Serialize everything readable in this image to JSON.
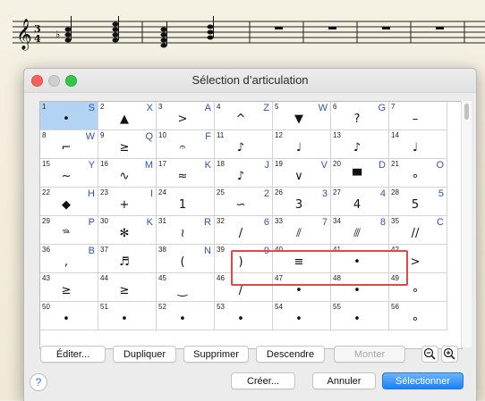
{
  "dialog": {
    "title": "Sélection d’articulation",
    "buttons": {
      "edit": "Éditer...",
      "duplicate": "Dupliquer",
      "delete": "Supprimer",
      "move_down": "Descendre",
      "move_up": "Monter",
      "create": "Créer...",
      "cancel": "Annuler",
      "select": "Sélectionner",
      "help": "?"
    }
  },
  "articulations": [
    {
      "num": "1",
      "key": "S",
      "sym": "•"
    },
    {
      "num": "2",
      "key": "X",
      "sym": "▲"
    },
    {
      "num": "3",
      "key": "A",
      "sym": ">"
    },
    {
      "num": "4",
      "key": "Z",
      "sym": "^"
    },
    {
      "num": "5",
      "key": "W",
      "sym": "▼"
    },
    {
      "num": "6",
      "key": "G",
      "sym": "?"
    },
    {
      "num": "7",
      "key": "",
      "sym": "–"
    },
    {
      "num": "8",
      "key": "W",
      "sym": "⌐"
    },
    {
      "num": "9",
      "key": "Q",
      "sym": "≥"
    },
    {
      "num": "10",
      "key": "F",
      "sym": "𝄐"
    },
    {
      "num": "11",
      "key": "",
      "sym": "♪"
    },
    {
      "num": "12",
      "key": "",
      "sym": "♩"
    },
    {
      "num": "13",
      "key": "",
      "sym": "♪"
    },
    {
      "num": "14",
      "key": "",
      "sym": "♩"
    },
    {
      "num": "15",
      "key": "Y",
      "sym": "~"
    },
    {
      "num": "16",
      "key": "M",
      "sym": "∿"
    },
    {
      "num": "17",
      "key": "K",
      "sym": "≈"
    },
    {
      "num": "18",
      "key": "J",
      "sym": "♪"
    },
    {
      "num": "19",
      "key": "V",
      "sym": "∨"
    },
    {
      "num": "20",
      "key": "D",
      "sym": "▀"
    },
    {
      "num": "21",
      "key": "O",
      "sym": "∘"
    },
    {
      "num": "22",
      "key": "H",
      "sym": "◆"
    },
    {
      "num": "23",
      "key": "I",
      "sym": "+"
    },
    {
      "num": "24",
      "key": "",
      "sym": "1"
    },
    {
      "num": "25",
      "key": "2",
      "sym": "∽"
    },
    {
      "num": "26",
      "key": "3",
      "sym": "3"
    },
    {
      "num": "27",
      "key": "4",
      "sym": "4"
    },
    {
      "num": "28",
      "key": "5",
      "sym": "5"
    },
    {
      "num": "29",
      "key": "P",
      "sym": "𝆮"
    },
    {
      "num": "30",
      "key": "K",
      "sym": "✻"
    },
    {
      "num": "31",
      "key": "R",
      "sym": "≀"
    },
    {
      "num": "32",
      "key": "6",
      "sym": "/"
    },
    {
      "num": "33",
      "key": "7",
      "sym": "⫽"
    },
    {
      "num": "34",
      "key": "8",
      "sym": "⫻"
    },
    {
      "num": "35",
      "key": "C",
      "sym": "//"
    },
    {
      "num": "36",
      "key": "B",
      "sym": ","
    },
    {
      "num": "37",
      "key": "",
      "sym": "♬"
    },
    {
      "num": "38",
      "key": "N",
      "sym": "("
    },
    {
      "num": "39",
      "key": "9",
      "sym": ")"
    },
    {
      "num": "40",
      "key": "",
      "sym": "≡"
    },
    {
      "num": "41",
      "key": "",
      "sym": "•"
    },
    {
      "num": "42",
      "key": "",
      "sym": ">"
    },
    {
      "num": "43",
      "key": "",
      "sym": "≥"
    },
    {
      "num": "44",
      "key": "",
      "sym": "≥"
    },
    {
      "num": "45",
      "key": "",
      "sym": "‿"
    },
    {
      "num": "46",
      "key": "",
      "sym": "/"
    },
    {
      "num": "47",
      "key": "",
      "sym": "•"
    },
    {
      "num": "48",
      "key": "",
      "sym": "•"
    },
    {
      "num": "49",
      "key": "",
      "sym": "∘"
    },
    {
      "num": "50",
      "key": "",
      "sym": "•"
    },
    {
      "num": "51",
      "key": "",
      "sym": "•"
    },
    {
      "num": "52",
      "key": "",
      "sym": "•"
    },
    {
      "num": "53",
      "key": "",
      "sym": "•"
    },
    {
      "num": "54",
      "key": "",
      "sym": "•"
    },
    {
      "num": "55",
      "key": "",
      "sym": "•"
    },
    {
      "num": "56",
      "key": "",
      "sym": "∘"
    }
  ],
  "selected_index": 0,
  "colors": {
    "accent": "#1a82fb",
    "highlight_box": "#e0474c",
    "selected_cell": "#b3d3f5"
  }
}
